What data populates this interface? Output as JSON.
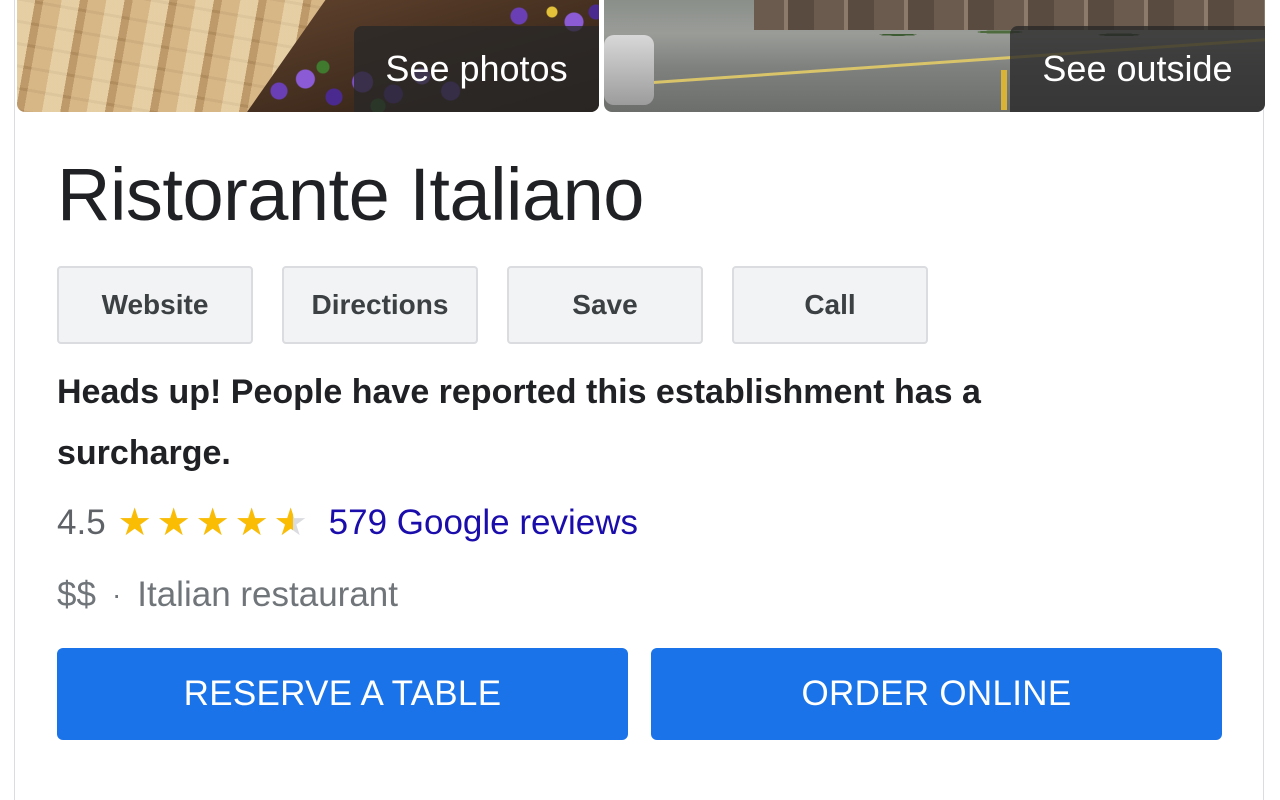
{
  "photos": {
    "left_label": "See photos",
    "right_label": "See outside"
  },
  "place": {
    "name": "Ristorante Italiano"
  },
  "actions": [
    {
      "label": "Website"
    },
    {
      "label": "Directions"
    },
    {
      "label": "Save"
    },
    {
      "label": "Call"
    }
  ],
  "notice": {
    "text": "Heads up! People have reported this establishment has a surcharge."
  },
  "rating": {
    "value": "4.5",
    "stars_out_of_5": 4.5,
    "reviews_link": "579 Google reviews",
    "star_color": "#fbbc04",
    "link_color": "#1a0dab"
  },
  "meta": {
    "price": "$$",
    "separator": "·",
    "category": "Italian restaurant"
  },
  "primary_buttons": {
    "reserve": "RESERVE A TABLE",
    "order": "ORDER ONLINE",
    "color": "#1a73e8"
  }
}
